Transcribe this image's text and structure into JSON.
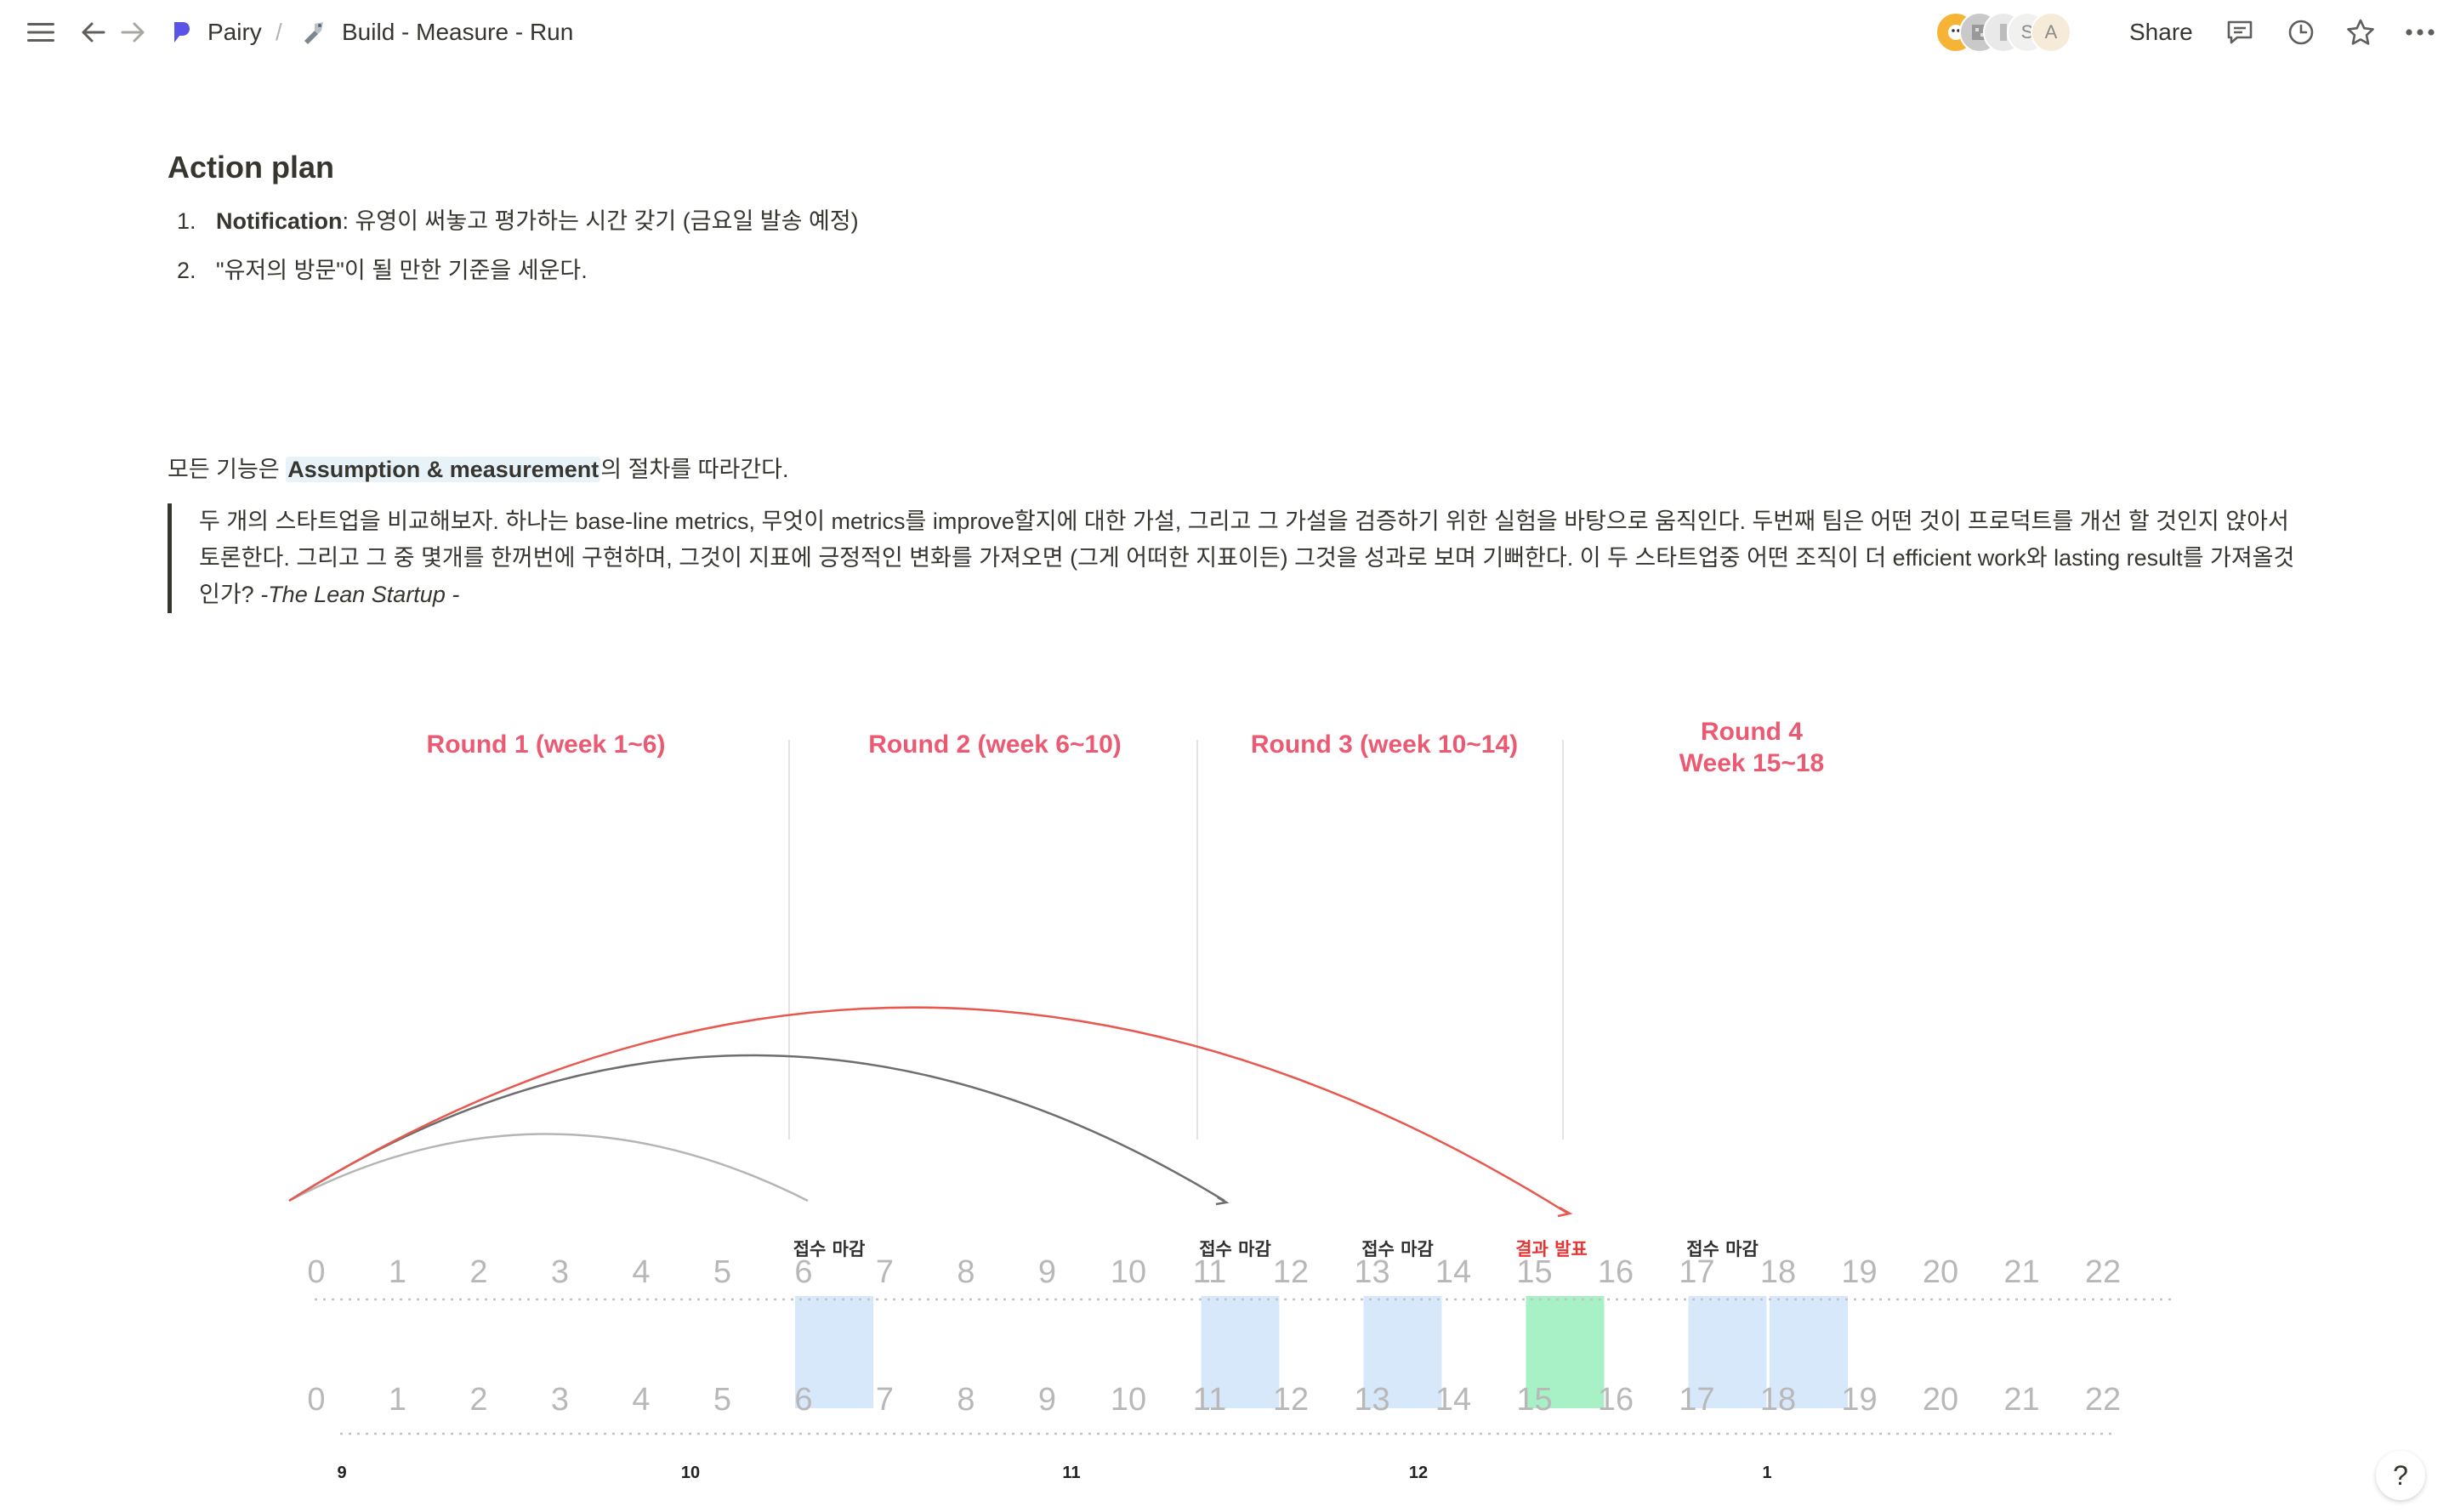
{
  "topbar": {
    "workspace": "Pairy",
    "separator": "/",
    "page_title": "Build - Measure - Run",
    "share_label": "Share",
    "avatar_letters": [
      "S",
      "A"
    ],
    "icons": [
      "menu-icon",
      "back-arrow-icon",
      "forward-arrow-icon",
      "pairy-logo-icon",
      "page-emoji-icon",
      "comment-icon",
      "history-clock-icon",
      "star-icon",
      "more-dots-icon"
    ]
  },
  "section_heading": "Action plan",
  "action_items": [
    {
      "num": "1.",
      "bold": "Notification",
      "text": ": 유영이 써놓고 평가하는 시간 갖기 (금요일 발송 예정)"
    },
    {
      "num": "2.",
      "bold": "",
      "text": "\"유저의 방문\"이 될 만한 기준을 세운다."
    }
  ],
  "paragraph": {
    "prefix": "모든 기능은 ",
    "highlight": "Assumption & measurement",
    "suffix": "의 절차를 따라간다."
  },
  "quote": {
    "text": "두 개의 스타트업을 비교해보자. 하나는 base-line metrics, 무엇이 metrics를 improve할지에 대한 가설, 그리고 그 가설을 검증하기 위한 실험을 바탕으로 움직인다. 두번째 팀은 어떤 것이 프로덕트를 개선 할 것인지 앉아서 토론한다. 그리고 그 중 몇개를 한꺼번에 구현하며, 그것이 지표에 긍정적인 변화를 가져오면 (그게 어떠한 지표이든) 그것을 성과로 보며 기뻐한다. 이 두 스타트업중 어떤 조직이 더 efficient work와 lasting result를 가져올것인가? ",
    "citation": "-The Lean Startup -"
  },
  "timeline": {
    "rounds": [
      {
        "line1": "Round 1 (week 1~6)",
        "line2": ""
      },
      {
        "line1": "Round 2 (week 6~10)",
        "line2": ""
      },
      {
        "line1": "Round 3 (week 10~14)",
        "line2": ""
      },
      {
        "line1": "Round 4",
        "line2": "Week 15~18"
      }
    ],
    "weeks": [
      "0",
      "1",
      "2",
      "3",
      "4",
      "5",
      "6",
      "7",
      "8",
      "9",
      "10",
      "11",
      "12",
      "13",
      "14",
      "15",
      "16",
      "17",
      "18",
      "19",
      "20",
      "21",
      "22"
    ],
    "deadline_label": "접수 마감",
    "announce_label": "결과 발표",
    "deadline_weeks": [
      6,
      11,
      13,
      17
    ],
    "announce_week": 15,
    "highlight_weeks": [
      {
        "week": 6,
        "kind": "deadline"
      },
      {
        "week": 11,
        "kind": "deadline"
      },
      {
        "week": 13,
        "kind": "deadline"
      },
      {
        "week": 15,
        "kind": "announce"
      },
      {
        "week": 17,
        "kind": "deadline"
      },
      {
        "week": 18,
        "kind": "deadline"
      }
    ],
    "month_labels": [
      "9",
      "10",
      "11",
      "12",
      "1"
    ],
    "colors": {
      "round_text": "#eb5a72",
      "deadline_fill": "#d8e8fb",
      "announce_fill": "#a8f0c6",
      "announce_text": "#e53535",
      "week_number": "#b8b8b8",
      "arc_red": "#e8584f",
      "arc_dark": "#6e6e6e",
      "arc_light": "#b5b5b5"
    }
  },
  "help_label": "?"
}
